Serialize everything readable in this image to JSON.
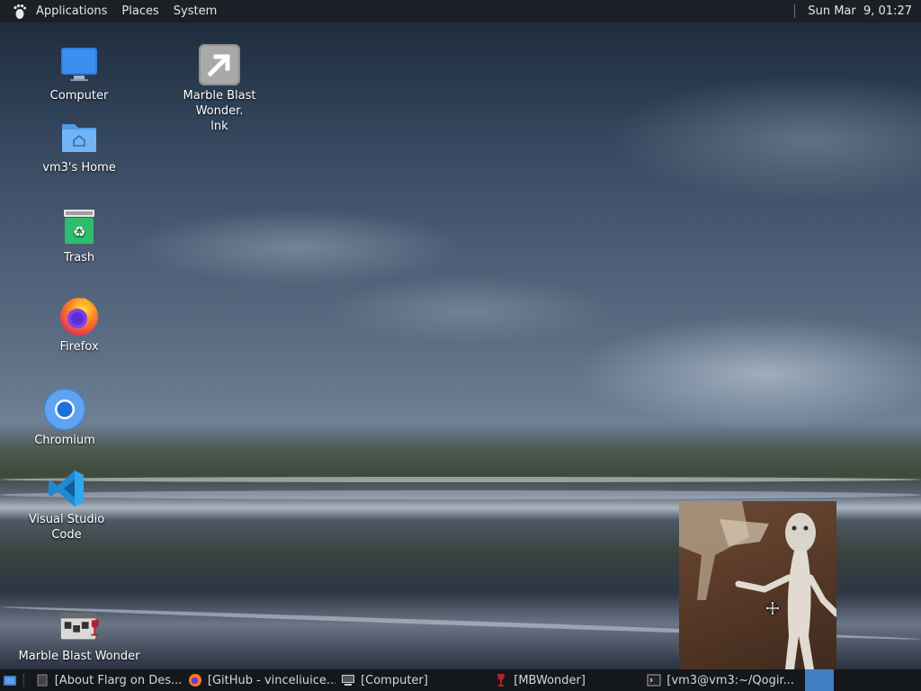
{
  "top_panel": {
    "menus": [
      "Applications",
      "Places",
      "System"
    ],
    "clock": "Sun Mar  9, 01:27"
  },
  "desktop_icons": {
    "computer": "Computer",
    "home": "vm3's Home",
    "trash": "Trash",
    "firefox": "Firefox",
    "chromium": "Chromium",
    "vscode": "Visual Studio Code",
    "marble_lnk": "Marble Blast Wonder.\nlnk",
    "marble": "Marble Blast Wonder"
  },
  "taskbar": {
    "tasks": [
      {
        "label": "[About Flarg on Des...",
        "icon": "document-icon"
      },
      {
        "label": "[GitHub - vinceliuice...",
        "icon": "firefox-icon"
      },
      {
        "label": "[Computer]",
        "icon": "computer-icon"
      },
      {
        "label": "[MBWonder]",
        "icon": "wine-icon"
      },
      {
        "label": "[vm3@vm3:~/Qogir...",
        "icon": "terminal-icon"
      }
    ]
  },
  "colors": {
    "panel_bg": "#1b1f26",
    "workspace_active": "#3f7fc4"
  }
}
